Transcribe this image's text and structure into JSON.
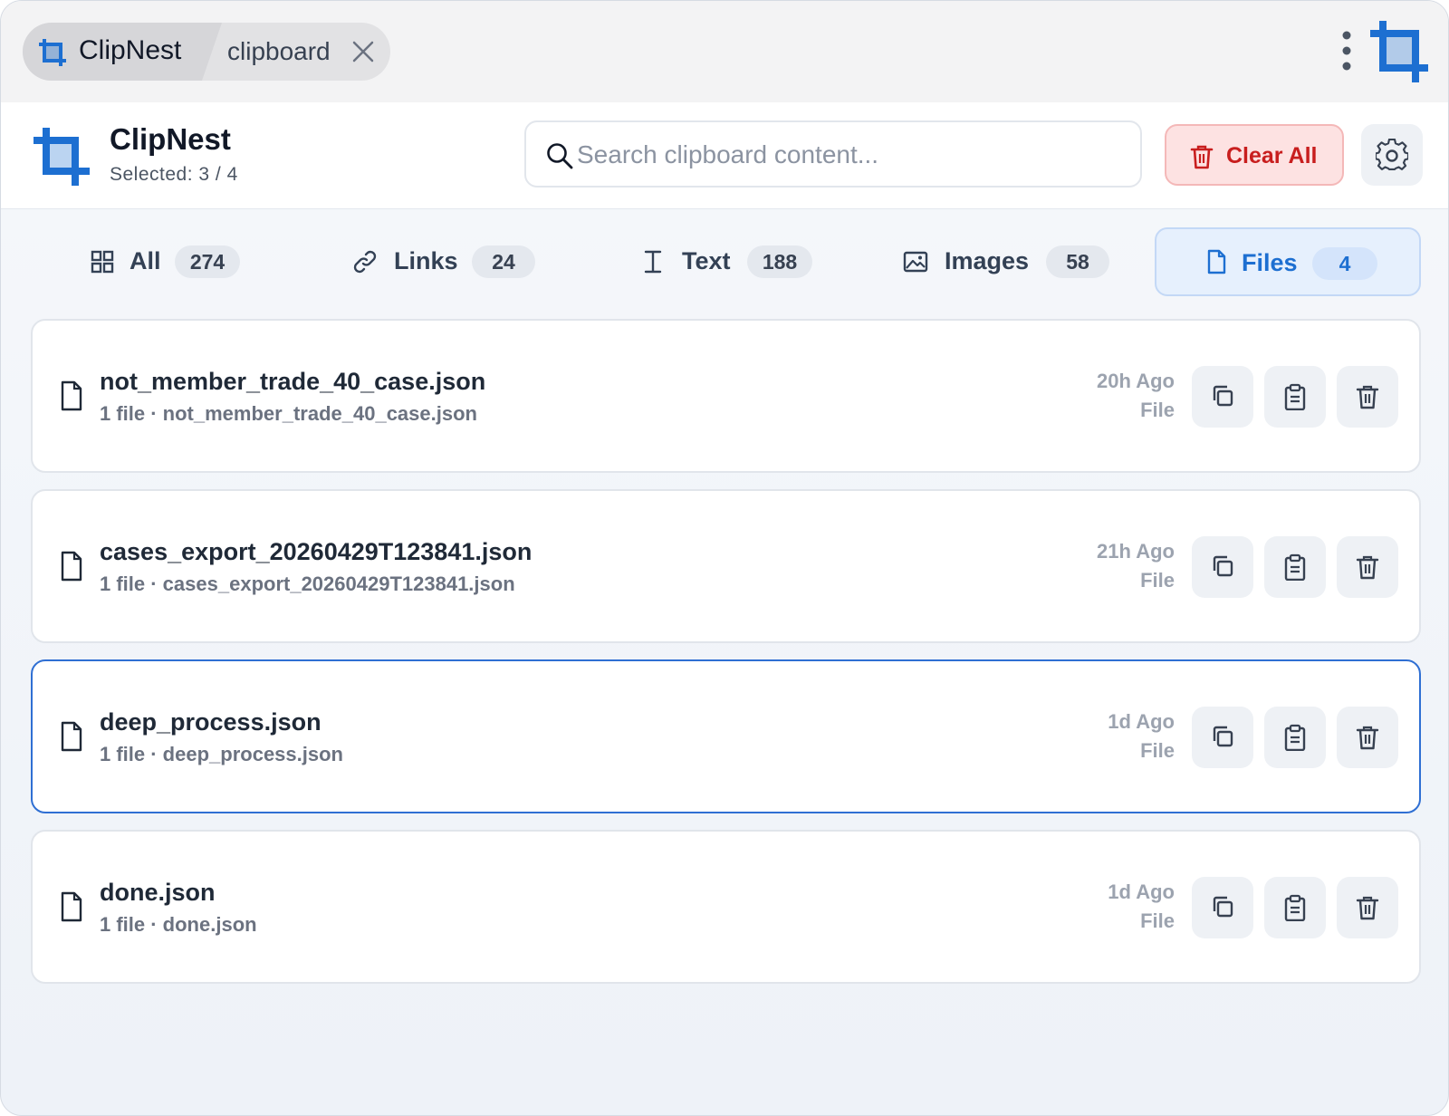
{
  "window": {
    "app_name": "ClipNest",
    "tab_label": "clipboard"
  },
  "header": {
    "title": "ClipNest",
    "subtitle": "Selected: 3 / 4",
    "search_placeholder": "Search clipboard content...",
    "search_value": "",
    "clear_all_label": "Clear All"
  },
  "tabs": [
    {
      "label": "All",
      "count": "274",
      "icon": "grid-icon",
      "active": false
    },
    {
      "label": "Links",
      "count": "24",
      "icon": "link-icon",
      "active": false
    },
    {
      "label": "Text",
      "count": "188",
      "icon": "text-cursor-icon",
      "active": false
    },
    {
      "label": "Images",
      "count": "58",
      "icon": "image-icon",
      "active": false
    },
    {
      "label": "Files",
      "count": "4",
      "icon": "file-icon",
      "active": true
    }
  ],
  "items": [
    {
      "name": "not_member_trade_40_case.json",
      "meta": "1 file · not_member_trade_40_case.json",
      "time": "20h Ago",
      "kind": "File",
      "selected": false
    },
    {
      "name": "cases_export_20260429T123841.json",
      "meta": "1 file · cases_export_20260429T123841.json",
      "time": "21h Ago",
      "kind": "File",
      "selected": false
    },
    {
      "name": "deep_process.json",
      "meta": "1 file · deep_process.json",
      "time": "1d Ago",
      "kind": "File",
      "selected": true
    },
    {
      "name": "done.json",
      "meta": "1 file · done.json",
      "time": "1d Ago",
      "kind": "File",
      "selected": false
    }
  ],
  "colors": {
    "accent": "#1d6fd1",
    "danger": "#c81e1e",
    "danger_bg": "#fde2e2"
  }
}
